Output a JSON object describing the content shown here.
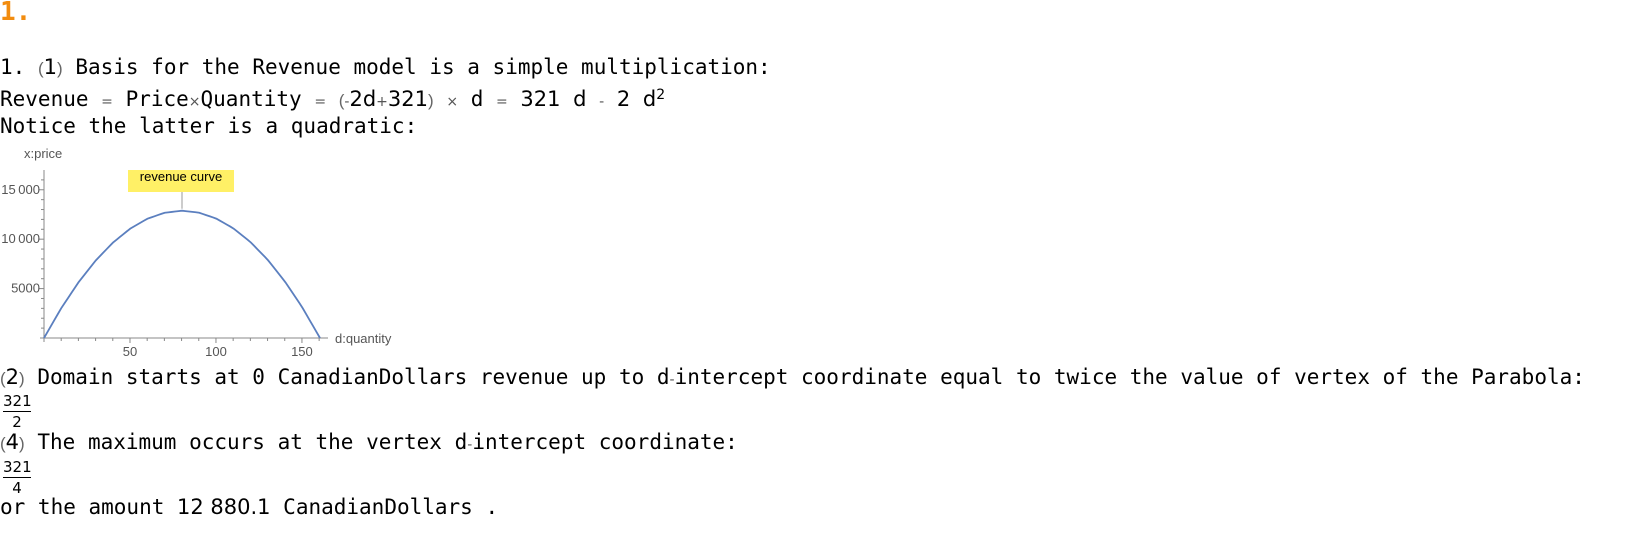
{
  "heading": "1.",
  "line1": {
    "label": "1.",
    "open": "(",
    "num": "1",
    "close": ")",
    "text": "Basis for the Revenue model is a simple multiplication:"
  },
  "line2": {
    "revenue": "Revenue",
    "eq1": "=",
    "price": "Price",
    "times1": "×",
    "quantity": "Quantity",
    "eq2": "=",
    "open": "(",
    "minus1": "-",
    "term1": "2d",
    "plus": "+",
    "const": "321",
    "close": ")",
    "times2": "×",
    "d": "d",
    "eq3": "=",
    "coef1": "321",
    "d1": "d",
    "minus2": "-",
    "coef2": "2",
    "d2": "d",
    "exp": "2"
  },
  "line3": "Notice the latter is a quadratic:",
  "chart_data": {
    "type": "line",
    "ylabel": "x:price",
    "xlabel": "d:quantity",
    "xlim": [
      0,
      160.5
    ],
    "ylim": [
      0,
      17000
    ],
    "x_ticks": [
      50,
      100,
      150
    ],
    "y_ticks": [
      5000,
      10000,
      15000
    ],
    "callout": "revenue curve",
    "series": [
      {
        "color": "#5b7fbf",
        "x": [
          0,
          10,
          20,
          30,
          40,
          50,
          60,
          70,
          80.25,
          90,
          100,
          110,
          120,
          130,
          140,
          150,
          160.5
        ],
        "y": [
          0,
          3010,
          5620,
          7830,
          9640,
          11050,
          12060,
          12670,
          12880.1,
          12690,
          12100,
          11110,
          9720,
          7930,
          5740,
          3150,
          0
        ]
      }
    ]
  },
  "step2": {
    "open": "(",
    "num": "2",
    "close": ")",
    "text": "Domain starts at 0 CanadianDollars revenue up to d",
    "minus": "-",
    "text2": "intercept coordinate equal to twice the value of vertex of the Parabola:"
  },
  "frac2": {
    "num": "321",
    "den": "2"
  },
  "step4": {
    "open": "(",
    "num": "4",
    "close": ")",
    "text": "The maximum occurs at the vertex d",
    "minus": "-",
    "text2": "intercept coordinate:"
  },
  "frac4": {
    "num": "321",
    "den": "4"
  },
  "final": {
    "pre": "or the amount ",
    "amount": "12 880.1",
    "post": " CanadianDollars ."
  }
}
